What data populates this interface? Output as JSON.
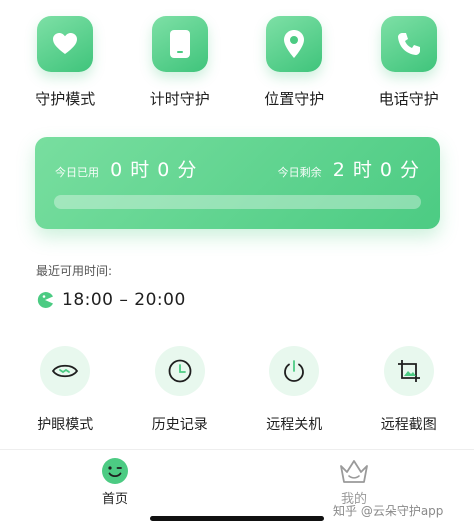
{
  "top_features": [
    {
      "label": "守护模式",
      "icon": "heart-icon"
    },
    {
      "label": "计时守护",
      "icon": "phone-device-icon"
    },
    {
      "label": "位置守护",
      "icon": "location-pin-icon"
    },
    {
      "label": "电话守护",
      "icon": "phone-call-icon"
    }
  ],
  "usage": {
    "used_label": "今日已用",
    "used_value": "0 时 0 分",
    "remaining_label": "今日剩余",
    "remaining_value": "2 时 0 分",
    "used_fraction": 0
  },
  "recent": {
    "title": "最近可用时间:",
    "time_range": "18:00 – 20:00",
    "icon": "pacman-clock-icon"
  },
  "bottom_features": [
    {
      "label": "护眼模式",
      "icon": "eye-icon"
    },
    {
      "label": "历史记录",
      "icon": "clock-icon"
    },
    {
      "label": "远程关机",
      "icon": "power-icon"
    },
    {
      "label": "远程截图",
      "icon": "screenshot-icon"
    }
  ],
  "tabs": {
    "home": {
      "label": "首页",
      "icon": "smiley-icon",
      "active": true
    },
    "mine": {
      "label": "我的",
      "icon": "crown-icon",
      "active": false
    }
  },
  "watermark": "知乎 @云朵守护app",
  "colors": {
    "accent": "#4ccb83",
    "accent_light": "#7ee0a6",
    "icon_bg": "#e8f8ee"
  }
}
